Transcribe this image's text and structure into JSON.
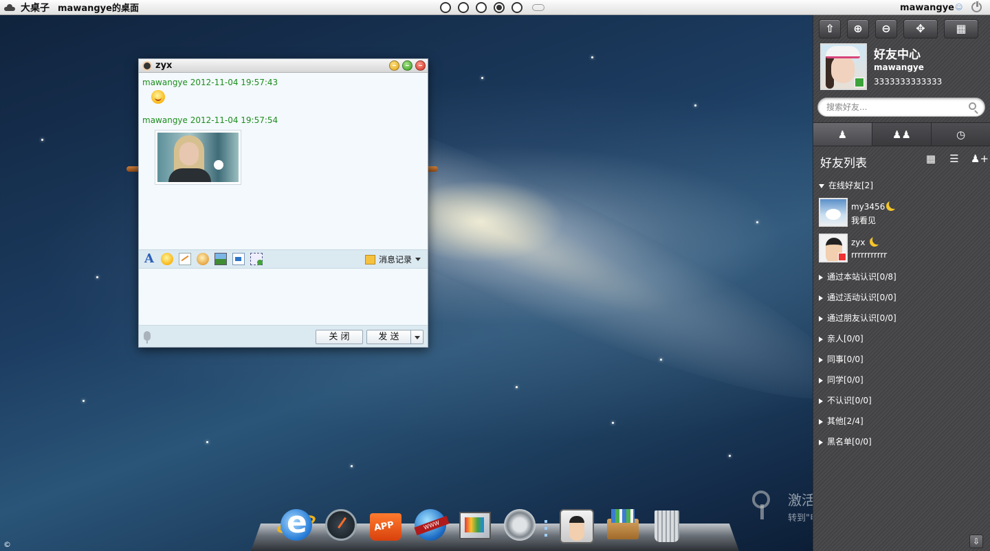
{
  "topbar": {
    "app_name": "大桌子",
    "desktop_title": "mawangye的桌面",
    "username": "mawangye",
    "desktop_count": 5,
    "active_desktop": 4
  },
  "chat": {
    "title": "zyx",
    "messages": [
      {
        "header": "mawangye 2012-11-04 19:57:43",
        "content_type": "emoticon"
      },
      {
        "header": "mawangye 2012-11-04 19:57:54",
        "content_type": "image"
      }
    ],
    "history_label": "消息记录",
    "close_label": "关 闭",
    "send_label": "发 送"
  },
  "friend_center": {
    "title": "好友中心",
    "username": "mawangye",
    "user_id": "3333333333333",
    "search_placeholder": "搜索好友...",
    "list_title": "好友列表",
    "online_group": "在线好友[2]",
    "online_friends": [
      {
        "name": "my3456",
        "signature": "我看见",
        "status_icon": "moon-icon"
      },
      {
        "name": "zyx",
        "signature": "rrrrrrrrrrr",
        "status_icon": "moon-icon"
      }
    ],
    "groups": [
      "通过本站认识[0/8]",
      "通过活动认识[0/0]",
      "通过朋友认识[0/0]",
      "亲人[0/0]",
      "同事[0/0]",
      "同学[0/0]",
      "不认识[0/0]",
      "其他[2/4]",
      "黑名单[0/0]"
    ]
  },
  "dock": {
    "items": [
      "ie-icon",
      "gauge-icon",
      "app-store-icon",
      "web-globe-icon",
      "paint-icon",
      "settings-icon",
      "contacts-icon",
      "files-icon",
      "trash-icon"
    ]
  },
  "watermark": {
    "title": "激活 Windows",
    "subtitle": "转到\"电脑设置\"以激活 Windows。"
  },
  "copyright_symbol": "©"
}
